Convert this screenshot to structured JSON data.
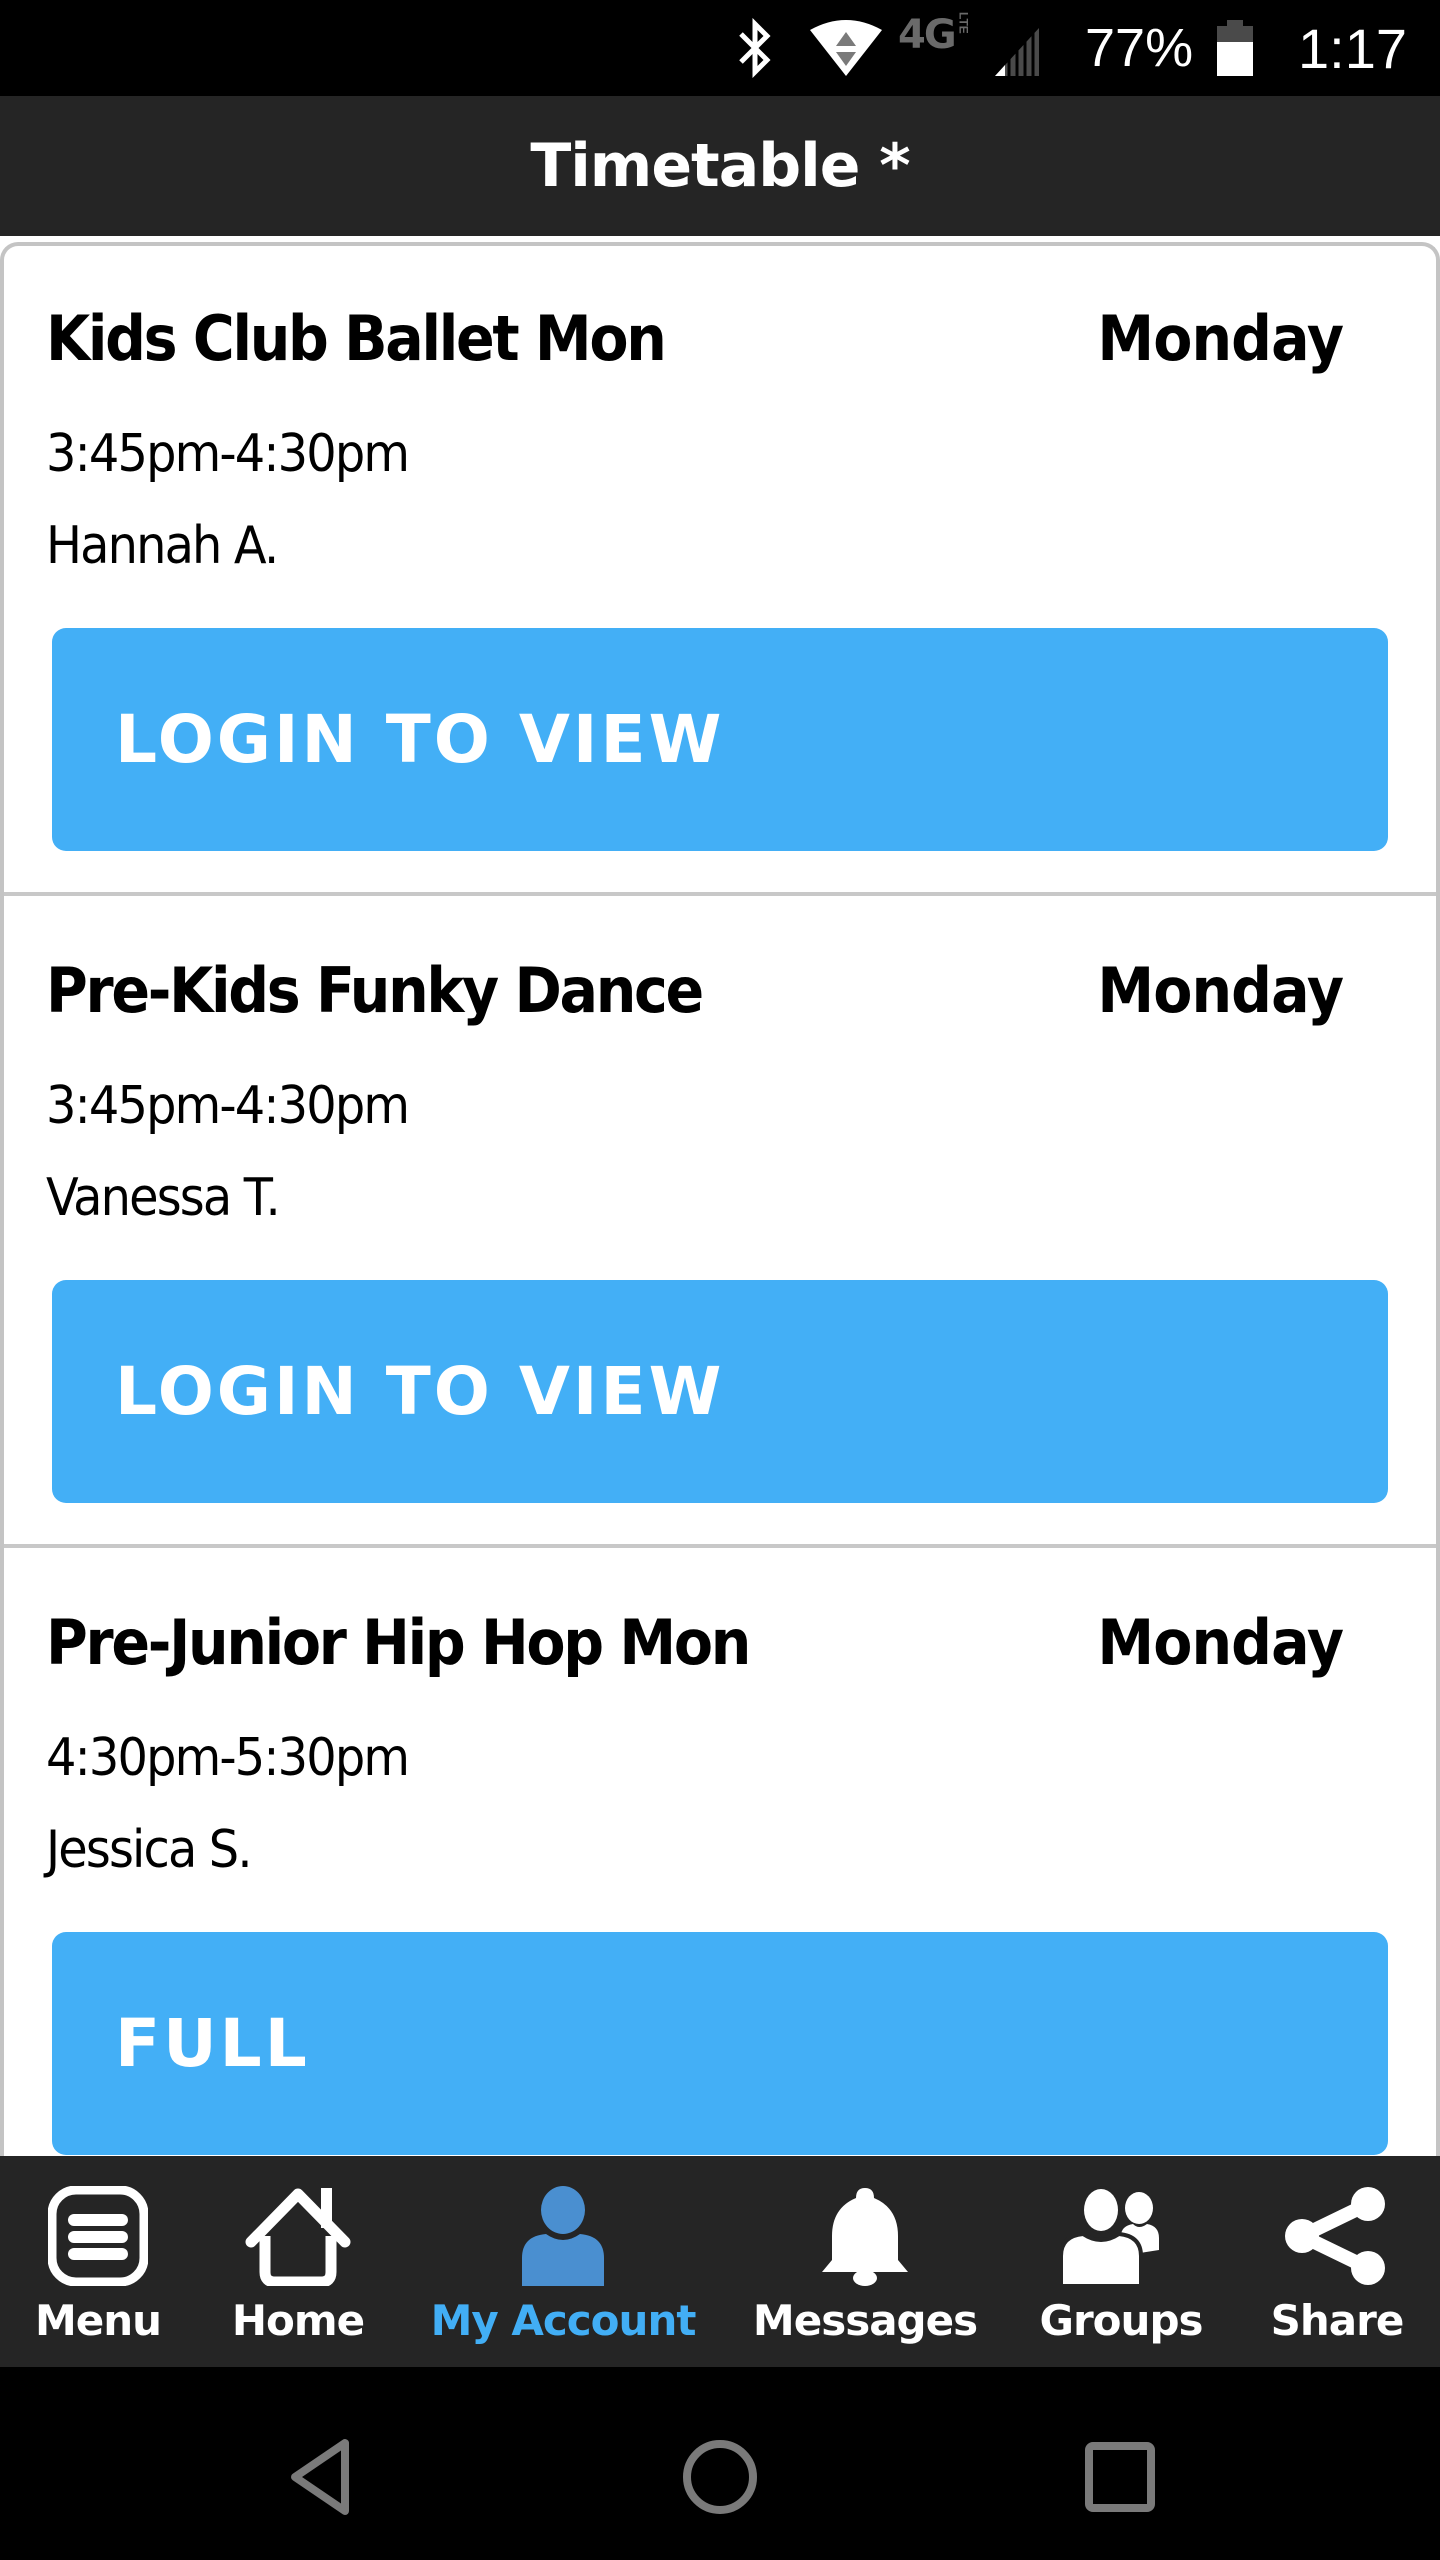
{
  "status_bar": {
    "icons": [
      "bluetooth-icon",
      "wifi-icon",
      "lte-4g-icon",
      "signal-icon",
      "battery-icon"
    ],
    "network_label": "4G",
    "network_sub": "LTE",
    "battery": "77%",
    "time": "1:17"
  },
  "header": {
    "title": "Timetable *"
  },
  "classes": [
    {
      "name": "Kids Club Ballet Mon",
      "day": "Monday",
      "time": "3:45pm-4:30pm",
      "instructor": "Hannah A.",
      "action": "LOGIN TO VIEW"
    },
    {
      "name": "Pre-Kids Funky Dance",
      "day": "Monday",
      "time": "3:45pm-4:30pm",
      "instructor": "Vanessa T.",
      "action": "LOGIN TO VIEW"
    },
    {
      "name": "Pre-Junior Hip Hop Mon",
      "day": "Monday",
      "time": "4:30pm-5:30pm",
      "instructor": "Jessica S.",
      "action": "FULL"
    }
  ],
  "bottom_nav": {
    "active": "My Account",
    "items": [
      {
        "label": "Menu",
        "icon": "menu-icon"
      },
      {
        "label": "Home",
        "icon": "home-icon"
      },
      {
        "label": "My Account",
        "icon": "account-icon"
      },
      {
        "label": "Messages",
        "icon": "bell-icon"
      },
      {
        "label": "Groups",
        "icon": "groups-icon"
      },
      {
        "label": "Share",
        "icon": "share-icon"
      }
    ]
  },
  "colors": {
    "accent": "#43aff6",
    "active_nav": "#42aef5",
    "header_bg": "#252525"
  }
}
